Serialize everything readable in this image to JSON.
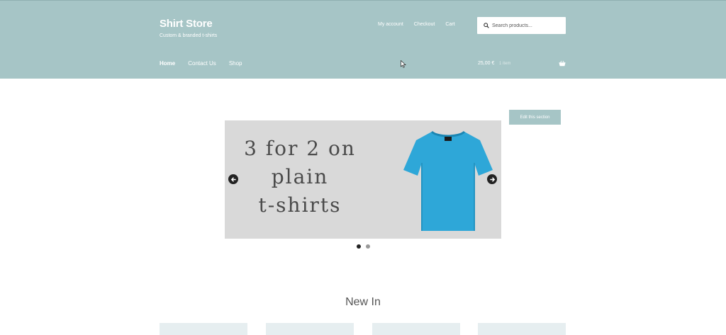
{
  "header": {
    "title": "Shirt Store",
    "tagline": "Custom & branded t-shirts",
    "top_links": [
      "My account",
      "Checkout",
      "Cart"
    ],
    "search": {
      "placeholder": "Search products..."
    },
    "nav": [
      "Home",
      "Contact Us",
      "Shop"
    ],
    "cart": {
      "total": "25,00 €",
      "count": "1 item"
    },
    "colors": {
      "header_bg": "#a6c5c6",
      "text": "#ffffff"
    }
  },
  "edit_button": {
    "label": "Edit this section"
  },
  "slider": {
    "lines": [
      "3 for 2 on",
      "plain",
      "t-shirts"
    ],
    "shirt_color": "#2ea7d8",
    "active_dot": 1,
    "dot_count": 2
  },
  "new_in": {
    "title": "New In"
  }
}
